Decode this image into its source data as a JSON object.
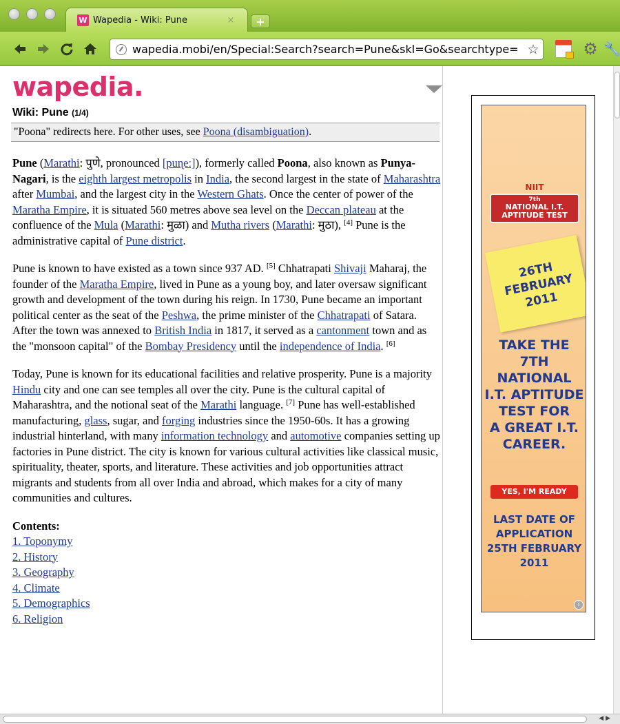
{
  "browser": {
    "tab_favicon": "W",
    "tab_title": "Wapedia - Wiki: Pune",
    "tab_close": "×",
    "new_tab": "+",
    "url": "wapedia.mobi/en/Special:Search?search=Pune&skl=Go&searchtype=",
    "toolbar_icons": [
      "back-arrow-icon",
      "forward-arrow-icon",
      "reload-icon",
      "home-icon",
      "star-icon",
      "calendar-extension-icon",
      "gear-icon",
      "wrench-icon"
    ],
    "accent": "#95c83d"
  },
  "page": {
    "logo": "wapedia.",
    "logo_color": "#d8316b",
    "title": "Wiki: Pune",
    "page_indicator": "(1/4)",
    "redirect": {
      "prefix": "\"Poona\" redirects here. For other uses, see ",
      "link": "Poona (disambiguation)",
      "suffix": "."
    },
    "link_color": "#1f3b97",
    "contents_heading": "Contents:",
    "toc": [
      "1. Toponymy",
      "2. History",
      "3. Geography",
      "4. Climate",
      "5. Demographics",
      "6. Religion"
    ]
  },
  "ad": {
    "brand": "NIIT",
    "ribbon_small": "7th",
    "ribbon": "NATIONAL I.T. APTITUDE TEST",
    "note_line1": "26TH FEBRUARY",
    "note_line2": "2011",
    "headline": "TAKE THE\n7TH NATIONAL\nI.T. APTITUDE\nTEST FOR\nA GREAT I.T.\nCAREER.",
    "cta": "YES, I'M READY",
    "deadline": "LAST DATE OF\nAPPLICATION\n25TH FEBRUARY\n2011",
    "info": "i"
  }
}
